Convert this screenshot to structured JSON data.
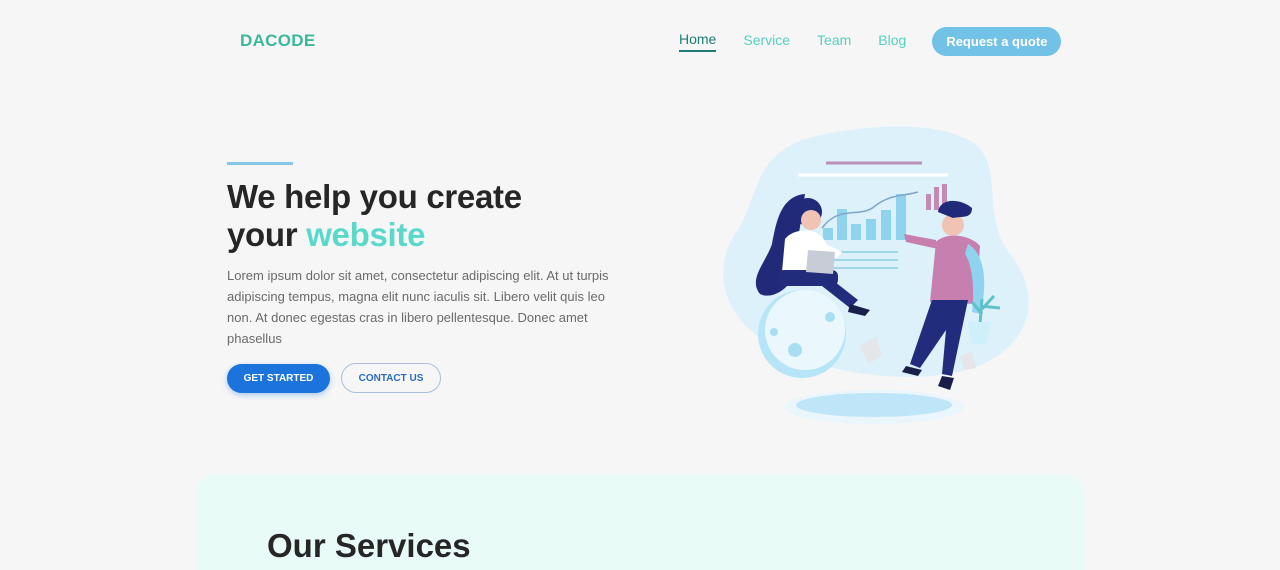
{
  "header": {
    "logo": "DACODE",
    "nav": [
      {
        "label": "Home",
        "active": true
      },
      {
        "label": "Service",
        "active": false
      },
      {
        "label": "Team",
        "active": false
      },
      {
        "label": "Blog",
        "active": false
      }
    ],
    "cta_label": "Request a quote"
  },
  "hero": {
    "title_line1": "We help you create",
    "title_line2_prefix": "your",
    "title_highlight": "website",
    "description": "Lorem ipsum dolor sit amet, consectetur adipiscing elit. At ut turpis adipiscing tempus, magna elit nunc iaculis sit. Libero velit quis leo non. At donec egestas cras in libero pellentesque. Donec amet phasellus",
    "primary_button": "GET STARTED",
    "secondary_button": "CONTACT US",
    "illustration_icon": "team-working-illustration"
  },
  "services": {
    "title": "Our Services"
  },
  "colors": {
    "background": "#f6f6f6",
    "brand_teal": "#3bb89a",
    "nav_active": "#1f7c75",
    "nav_link": "#55d0c0",
    "cta_blue": "#72c1e6",
    "primary_blue": "#1b73db",
    "highlight": "#5ad9cb",
    "services_bg": "#e8fbf7"
  }
}
